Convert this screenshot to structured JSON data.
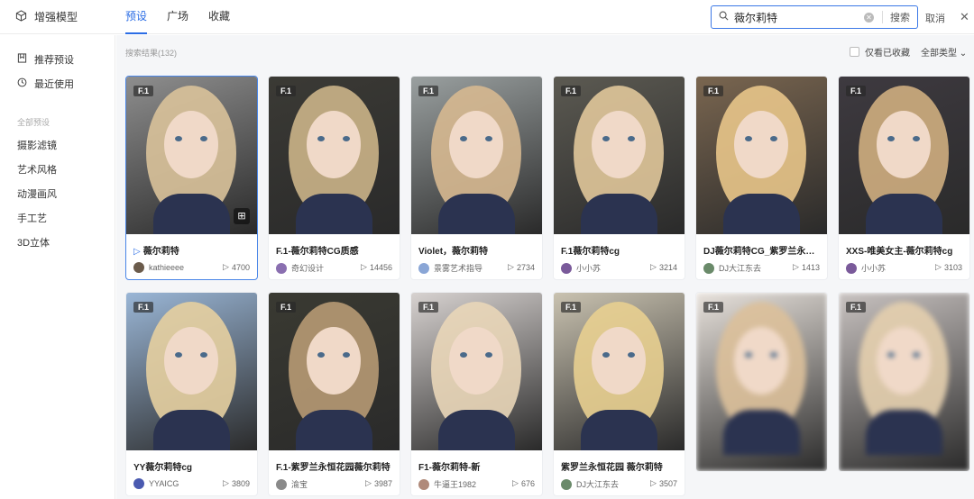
{
  "app": {
    "title": "增强模型"
  },
  "tabs": [
    {
      "label": "预设"
    },
    {
      "label": "广场"
    },
    {
      "label": "收藏"
    }
  ],
  "search": {
    "value": "薇尔莉特",
    "button": "搜索"
  },
  "header": {
    "cancel": "取消"
  },
  "sidebar": {
    "recommended": "推荐预设",
    "recent": "最近使用",
    "section": "全部预设",
    "categories": [
      "摄影滤镜",
      "艺术风格",
      "动漫画风",
      "手工艺",
      "3D立体"
    ]
  },
  "main": {
    "result_count": "搜索结果(132)",
    "only_favorites": "仅看已收藏",
    "type_filter": "全部类型"
  },
  "colors": {
    "accent": "#2b6de5"
  },
  "cards": [
    {
      "badge": "F.1",
      "title": "薇尔莉特",
      "author": "kathieeee",
      "plays": "4700",
      "bg": "#8e8e8e",
      "hair": "#d9c29a",
      "av": "#6b5b4b"
    },
    {
      "badge": "F.1",
      "title": "F.1-薇尔莉特CG质感",
      "author": "奇幻设计",
      "plays": "14456",
      "bg": "#3b3a35",
      "hair": "#cbb488",
      "av": "#8a6fb0"
    },
    {
      "badge": "F.1",
      "title": "Violet，薇尔莉特",
      "author": "景雾艺术指导",
      "plays": "2734",
      "bg": "#9aa0a0",
      "hair": "#d6b890",
      "av": "#8aa6d6"
    },
    {
      "badge": "F.1",
      "title": "F.1薇尔莉特cg",
      "author": "小小苏",
      "plays": "3214",
      "bg": "#5c5a52",
      "hair": "#e0c79a",
      "av": "#7a5a9a"
    },
    {
      "badge": "F.1",
      "title": "DJ薇尔莉特CG_紫罗兰永恒花园",
      "author": "DJ大江东去",
      "plays": "1413",
      "bg": "#7a6650",
      "hair": "#e8c58a",
      "av": "#6a8a6a"
    },
    {
      "badge": "F.1",
      "title": "XXS-唯美女主-薇尔莉特cg",
      "author": "小小苏",
      "plays": "3103",
      "bg": "#3e3a40",
      "hair": "#cfae80",
      "av": "#7a5a9a"
    },
    {
      "badge": "F.1",
      "title": "YY薇尔莉特cg",
      "author": "YYAICG",
      "plays": "3809",
      "bg": "#9ab6d6",
      "hair": "#e6cfa0",
      "av": "#4a5ab0"
    },
    {
      "badge": "F.1",
      "title": "F.1-紫罗兰永恒花园薇尔莉特",
      "author": "渝宝",
      "plays": "3987",
      "bg": "#3a3a32",
      "hair": "#b79a74",
      "av": "#8a8a8a"
    },
    {
      "badge": "F.1",
      "title": "F1-薇尔莉特-新",
      "author": "牛逼王1982",
      "plays": "676",
      "bg": "#d7d2d0",
      "hair": "#e9d6b8",
      "av": "#b08a7a"
    },
    {
      "badge": "F.1",
      "title": "紫罗兰永恒花园 薇尔莉特",
      "author": "DJ大江东去",
      "plays": "3507",
      "bg": "#c9c2b0",
      "hair": "#e8cf90",
      "av": "#6a8a6a"
    },
    {
      "badge": "F.1",
      "title": "",
      "author": "",
      "plays": "",
      "bg": "#e8e2dc",
      "hair": "#dcc09a",
      "av": "#ccc"
    },
    {
      "badge": "F.1",
      "title": "",
      "author": "",
      "plays": "",
      "bg": "#c8c2c0",
      "hair": "#e4cfae",
      "av": "#ccc"
    }
  ]
}
